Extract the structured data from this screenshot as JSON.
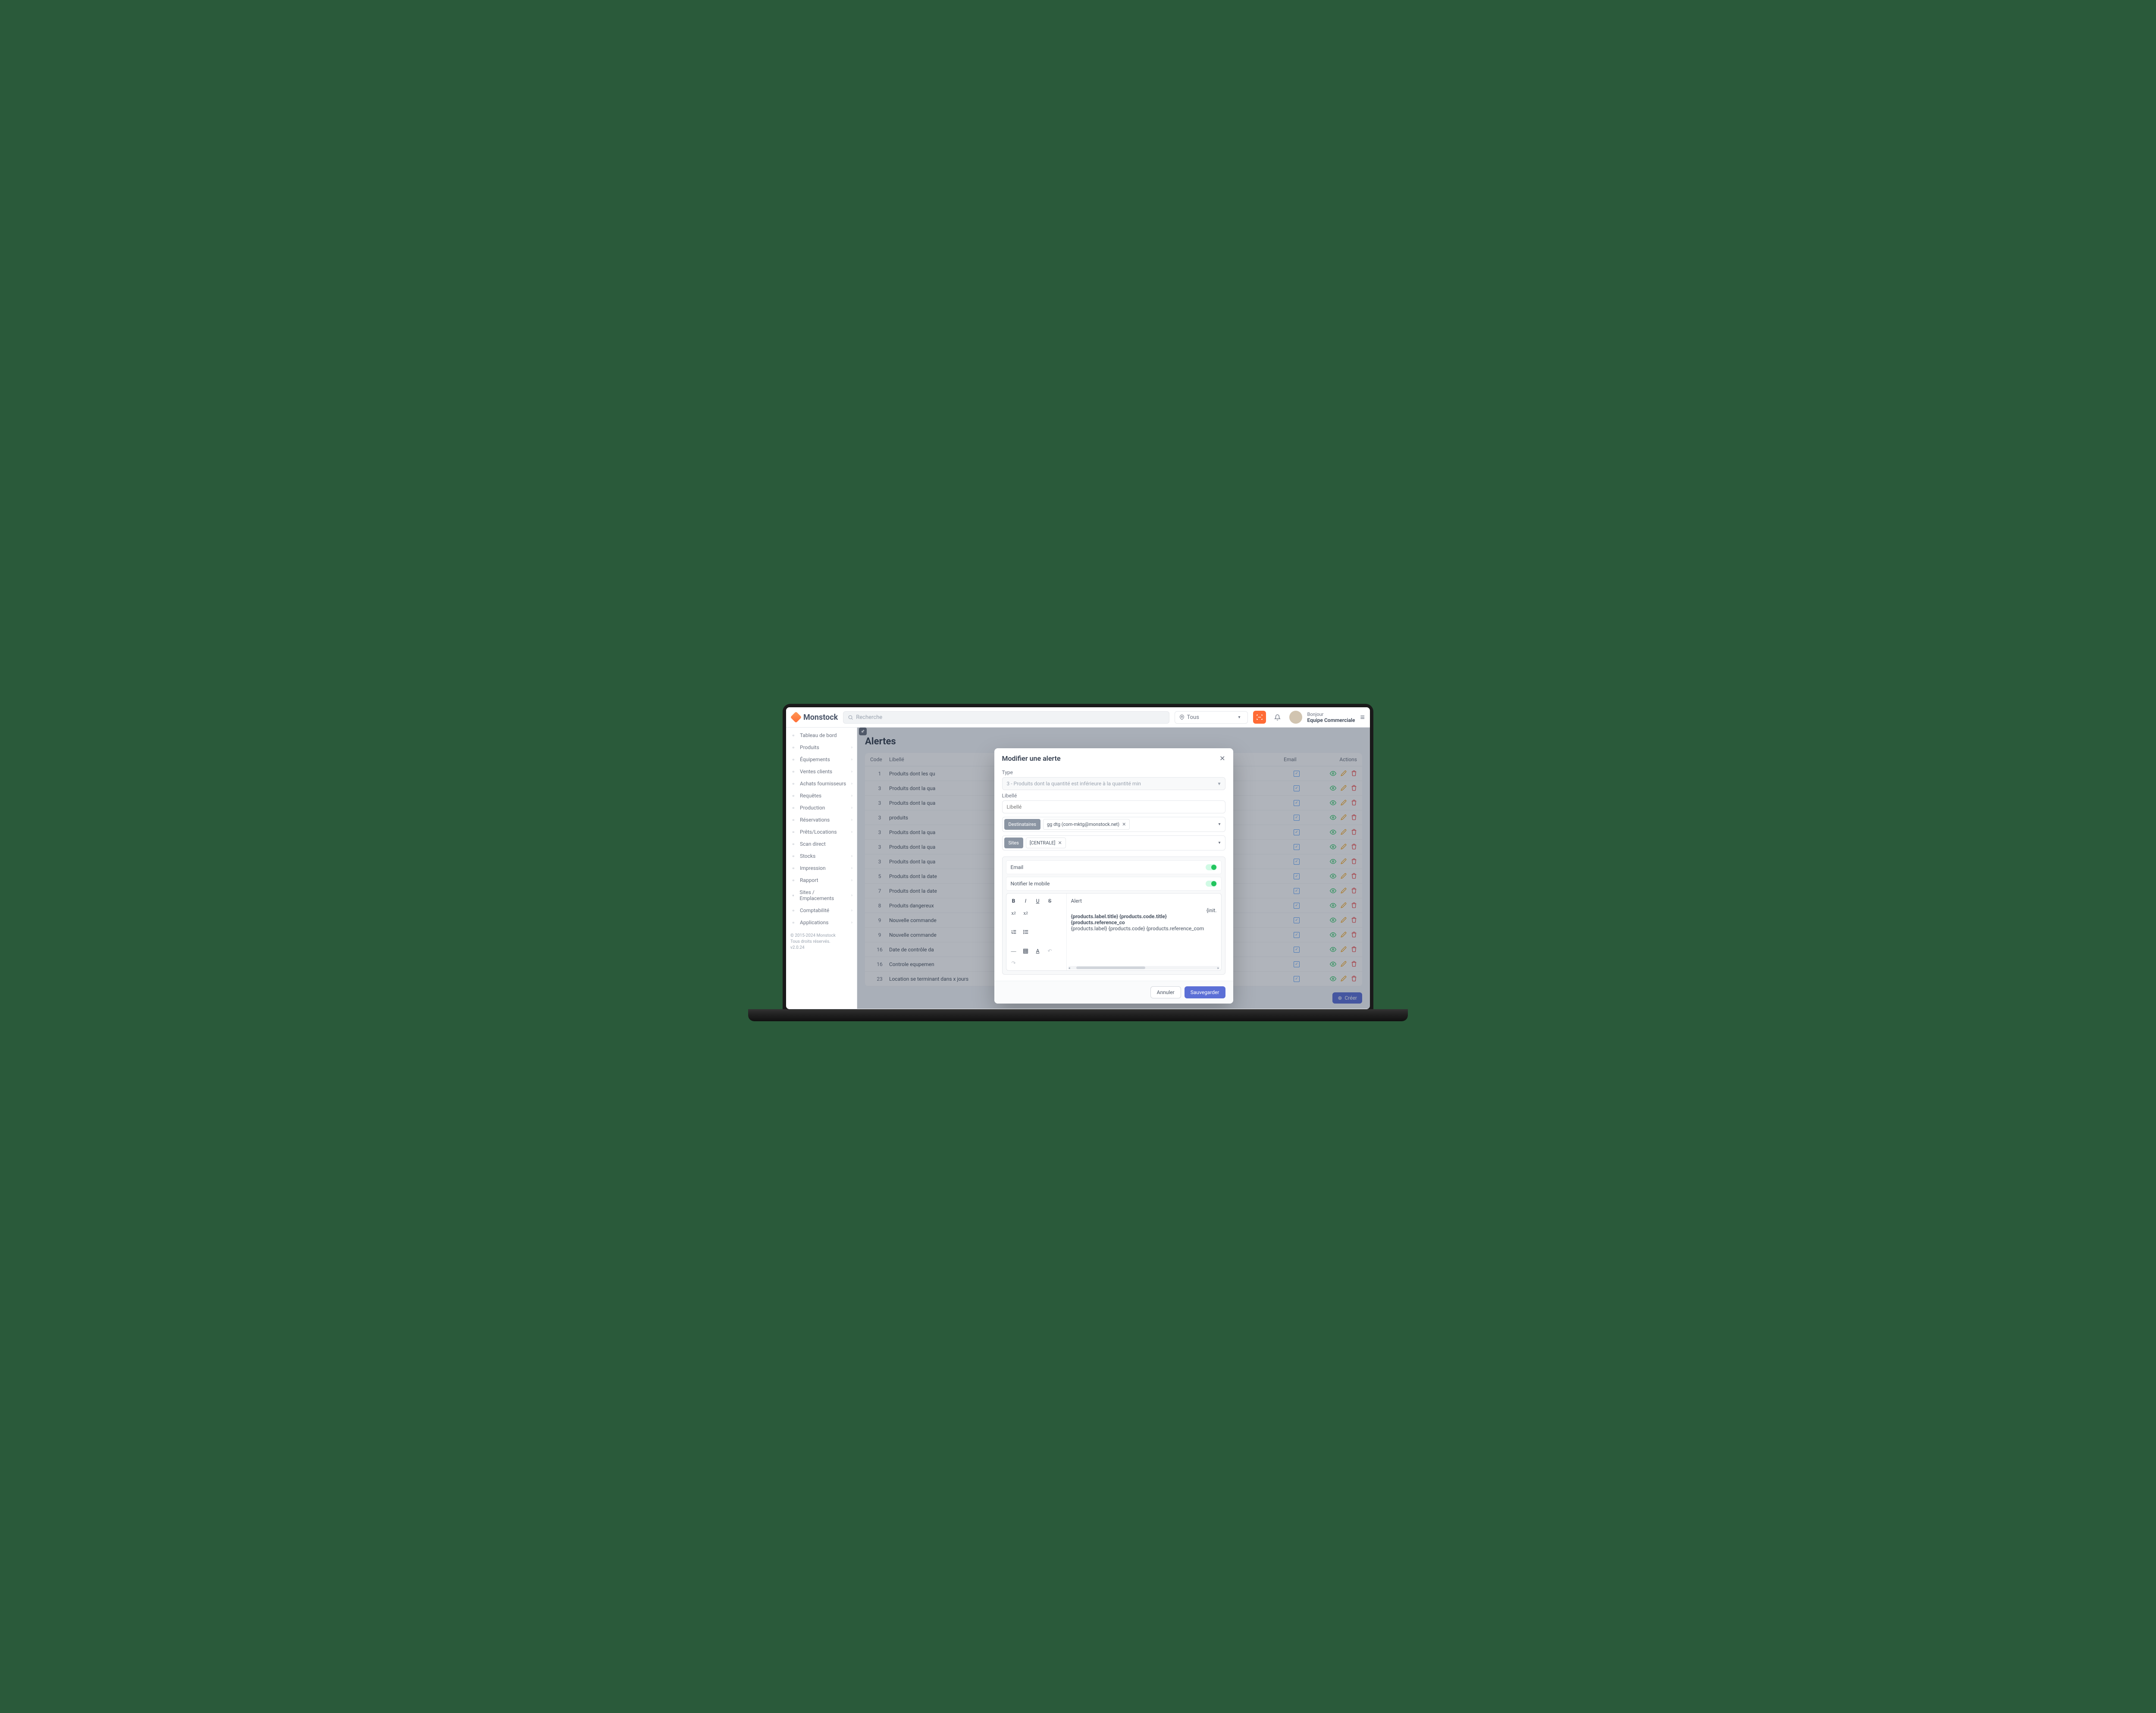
{
  "brand": "Monstock",
  "search_placeholder": "Recherche",
  "location_selected": "Tous",
  "user": {
    "greeting": "Bonjour",
    "name": "Equipe Commerciale"
  },
  "sidebar": {
    "items": [
      {
        "label": "Tableau de bord",
        "expandable": false
      },
      {
        "label": "Produits",
        "expandable": true
      },
      {
        "label": "Équipements",
        "expandable": true
      },
      {
        "label": "Ventes clients",
        "expandable": true
      },
      {
        "label": "Achats fournisseurs",
        "expandable": true
      },
      {
        "label": "Requêtes",
        "expandable": true
      },
      {
        "label": "Production",
        "expandable": true
      },
      {
        "label": "Réservations",
        "expandable": true
      },
      {
        "label": "Prêts/Locations",
        "expandable": true
      },
      {
        "label": "Scan direct",
        "expandable": false
      },
      {
        "label": "Stocks",
        "expandable": true
      },
      {
        "label": "Impression",
        "expandable": true
      },
      {
        "label": "Rapport",
        "expandable": true
      },
      {
        "label": "Sites / Emplacements",
        "expandable": true
      },
      {
        "label": "Comptabilité",
        "expandable": true
      },
      {
        "label": "Applications",
        "expandable": true
      }
    ],
    "footer": {
      "copyright": "© 2015-2024 Monstock",
      "rights": "Tous droits réservés.",
      "version": "v2.0.24"
    }
  },
  "page_title": "Alertes",
  "table": {
    "headers": {
      "code": "Code",
      "libelle": "Libellé",
      "email": "Email",
      "actions": "Actions"
    },
    "rows": [
      {
        "code": "1",
        "libelle": "Produits dont les qu"
      },
      {
        "code": "3",
        "libelle": "Produits dont la qua"
      },
      {
        "code": "3",
        "libelle": "Produits dont la qua"
      },
      {
        "code": "3",
        "libelle": "produits"
      },
      {
        "code": "3",
        "libelle": "Produits dont la qua"
      },
      {
        "code": "3",
        "libelle": "Produits dont la qua"
      },
      {
        "code": "3",
        "libelle": "Produits dont la qua"
      },
      {
        "code": "5",
        "libelle": "Produits dont la date"
      },
      {
        "code": "7",
        "libelle": "Produits dont la date"
      },
      {
        "code": "8",
        "libelle": "Produits dangereux"
      },
      {
        "code": "9",
        "libelle": "Nouvelle commande"
      },
      {
        "code": "9",
        "libelle": "Nouvelle commande"
      },
      {
        "code": "16",
        "libelle": "Date de contrôle da"
      },
      {
        "code": "16",
        "libelle": "Controle equpemen"
      },
      {
        "code": "23",
        "libelle": "Location se terminant dans x jours"
      }
    ]
  },
  "create_label": "Créer",
  "modal": {
    "title": "Modifier une alerte",
    "type_label": "Type",
    "type_value": "3 - Produits dont la quantité est inférieure à la quantité min",
    "libelle_label": "Libellé",
    "libelle_placeholder": "Libellé",
    "dest_label": "Destinataires",
    "dest_chip": "gg dtg (com-mktg@monstock.net)",
    "sites_label": "Sites",
    "sites_chip": "[CENTRALE]",
    "email_row": "Email",
    "mobile_row": "Notifier le mobile",
    "editor_heading": "Alert",
    "editor_init": "{init.",
    "editor_bold_row": "{products.label.title} {products.code.title} {products.reference_co",
    "editor_plain_row": "{products.label}            {products.code}            {products.reference_com",
    "cancel": "Annuler",
    "save": "Sauvegarder"
  }
}
